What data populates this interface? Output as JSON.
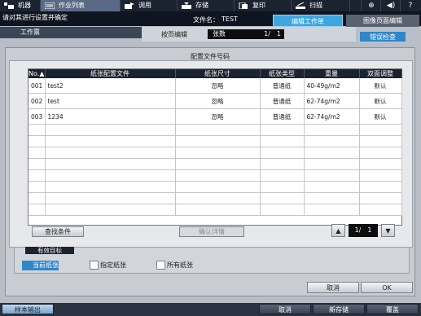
{
  "nav": {
    "items": [
      {
        "label": "机器",
        "icon": "machine-icon"
      },
      {
        "label": "作业列表",
        "icon": "job-list-icon"
      },
      {
        "label": "调用",
        "icon": "recall-icon"
      },
      {
        "label": "存储",
        "icon": "storage-icon"
      },
      {
        "label": "复印",
        "icon": "copy-icon"
      },
      {
        "label": "扫描",
        "icon": "scan-icon"
      }
    ],
    "extra_icons": [
      "globe-icon",
      "speaker-icon",
      "help-icon"
    ],
    "help_label": "?"
  },
  "status": {
    "message": "请对其进行设置并确定",
    "filename_label": "文件名：",
    "filename_value": "TEST"
  },
  "tabs": {
    "edit_job": "编辑工作单",
    "image_page_edit": "图像页面编辑"
  },
  "left_panel": {
    "title": "工作票"
  },
  "mode_bar": {
    "page_edit": "按页编辑",
    "count_label": "张数",
    "count_value": "1/　1"
  },
  "error_check": "错误检查",
  "dialog": {
    "title": "配置文件号码",
    "columns": [
      "No.▲",
      "纸张配置文件",
      "纸张尺寸",
      "纸张类型",
      "重量",
      "双面调整"
    ],
    "rows": [
      {
        "no": "001",
        "name": "test2",
        "size": "忽略",
        "type": "普通纸",
        "weight": "40-49g/m2",
        "duplex": "默认"
      },
      {
        "no": "002",
        "name": "test",
        "size": "忽略",
        "type": "普通纸",
        "weight": "62-74g/m2",
        "duplex": "默认"
      },
      {
        "no": "003",
        "name": "1234",
        "size": "忽略",
        "type": "普通纸",
        "weight": "62-74g/m2",
        "duplex": "默认"
      }
    ],
    "search_button": "查找条件",
    "confirm_button": "确认详情",
    "page_indicator": "1/　1",
    "target": {
      "title": "有效目标",
      "options": [
        {
          "label": "当前纸张",
          "selected": true
        },
        {
          "label": "指定纸张",
          "selected": false
        },
        {
          "label": "所有纸张",
          "selected": false
        }
      ]
    },
    "cancel_button": "取消",
    "ok_button": "OK"
  },
  "bottom": {
    "sample_output": "样本输出",
    "cancel": "取消",
    "new_save": "新存储",
    "overwrite": "覆盖"
  },
  "colors": {
    "accent": "#3da6df",
    "nav_bg": "#1b2230",
    "selected_option": "#2f86c9"
  }
}
